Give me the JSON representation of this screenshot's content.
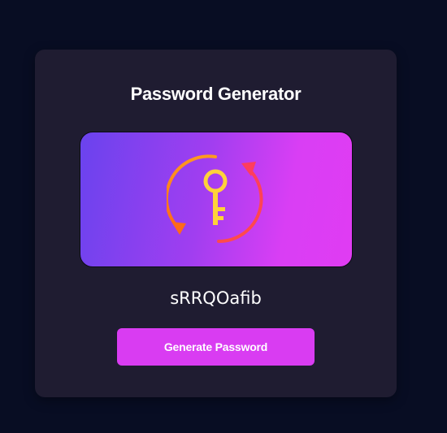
{
  "card": {
    "title": "Password Generator",
    "password": "sRRQOafib",
    "generate_label": "Generate Password",
    "hero_icon": "key-refresh-icon"
  },
  "colors": {
    "background": "#080d23",
    "card": "#1f1c31",
    "accent": "#d93cf2",
    "gradient_start": "#6a43ee",
    "gradient_end": "#e03cf3"
  }
}
